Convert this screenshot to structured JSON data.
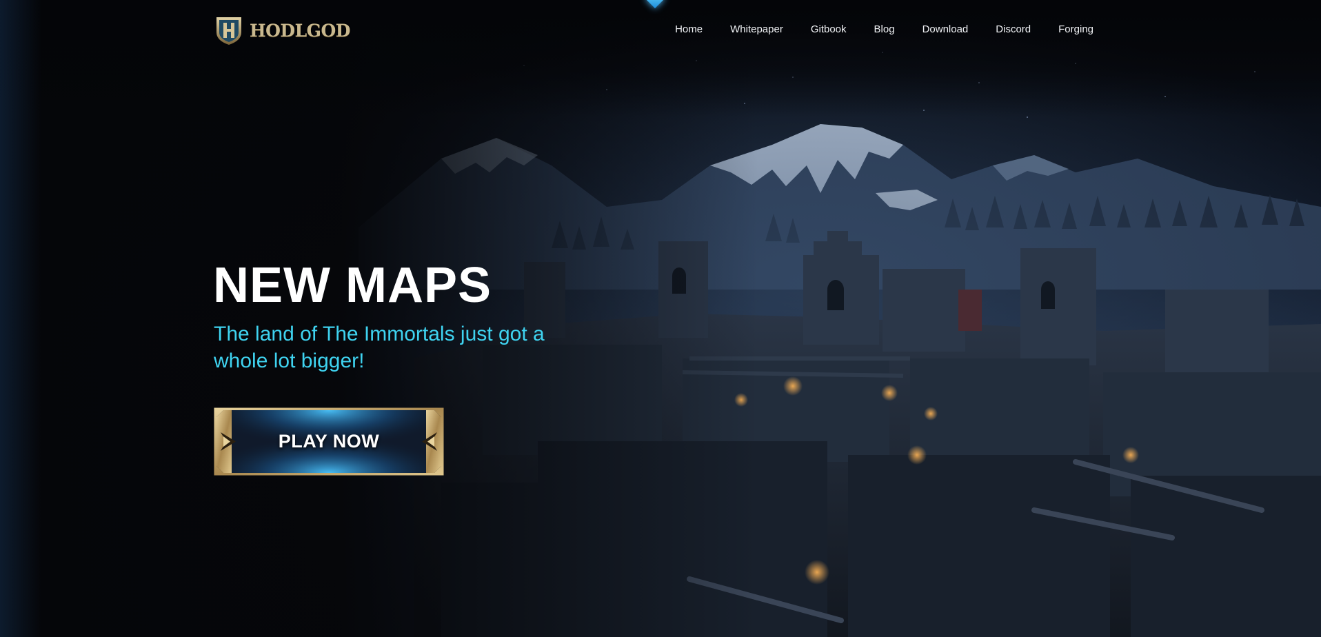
{
  "brand": {
    "name": "HODLGOD",
    "logo_icon": "shield-h-emblem",
    "logo_color": "#c9b88e"
  },
  "nav": {
    "items": [
      {
        "label": "Home"
      },
      {
        "label": "Whitepaper"
      },
      {
        "label": "Gitbook"
      },
      {
        "label": "Blog"
      },
      {
        "label": "Download"
      },
      {
        "label": "Discord"
      },
      {
        "label": "Forging"
      }
    ]
  },
  "hero": {
    "title": "NEW MAPS",
    "subtitle": "The land of The Immortals just got a whole lot bigger!",
    "cta_label": "PLAY NOW",
    "background_scene": "night ruined castle village with snowy mountains",
    "accent_color": "#3fd3f0"
  },
  "colors": {
    "background": "#06070a",
    "title": "#ffffff",
    "subtitle": "#3fd3f0",
    "button_frame": "#c2a66c"
  }
}
